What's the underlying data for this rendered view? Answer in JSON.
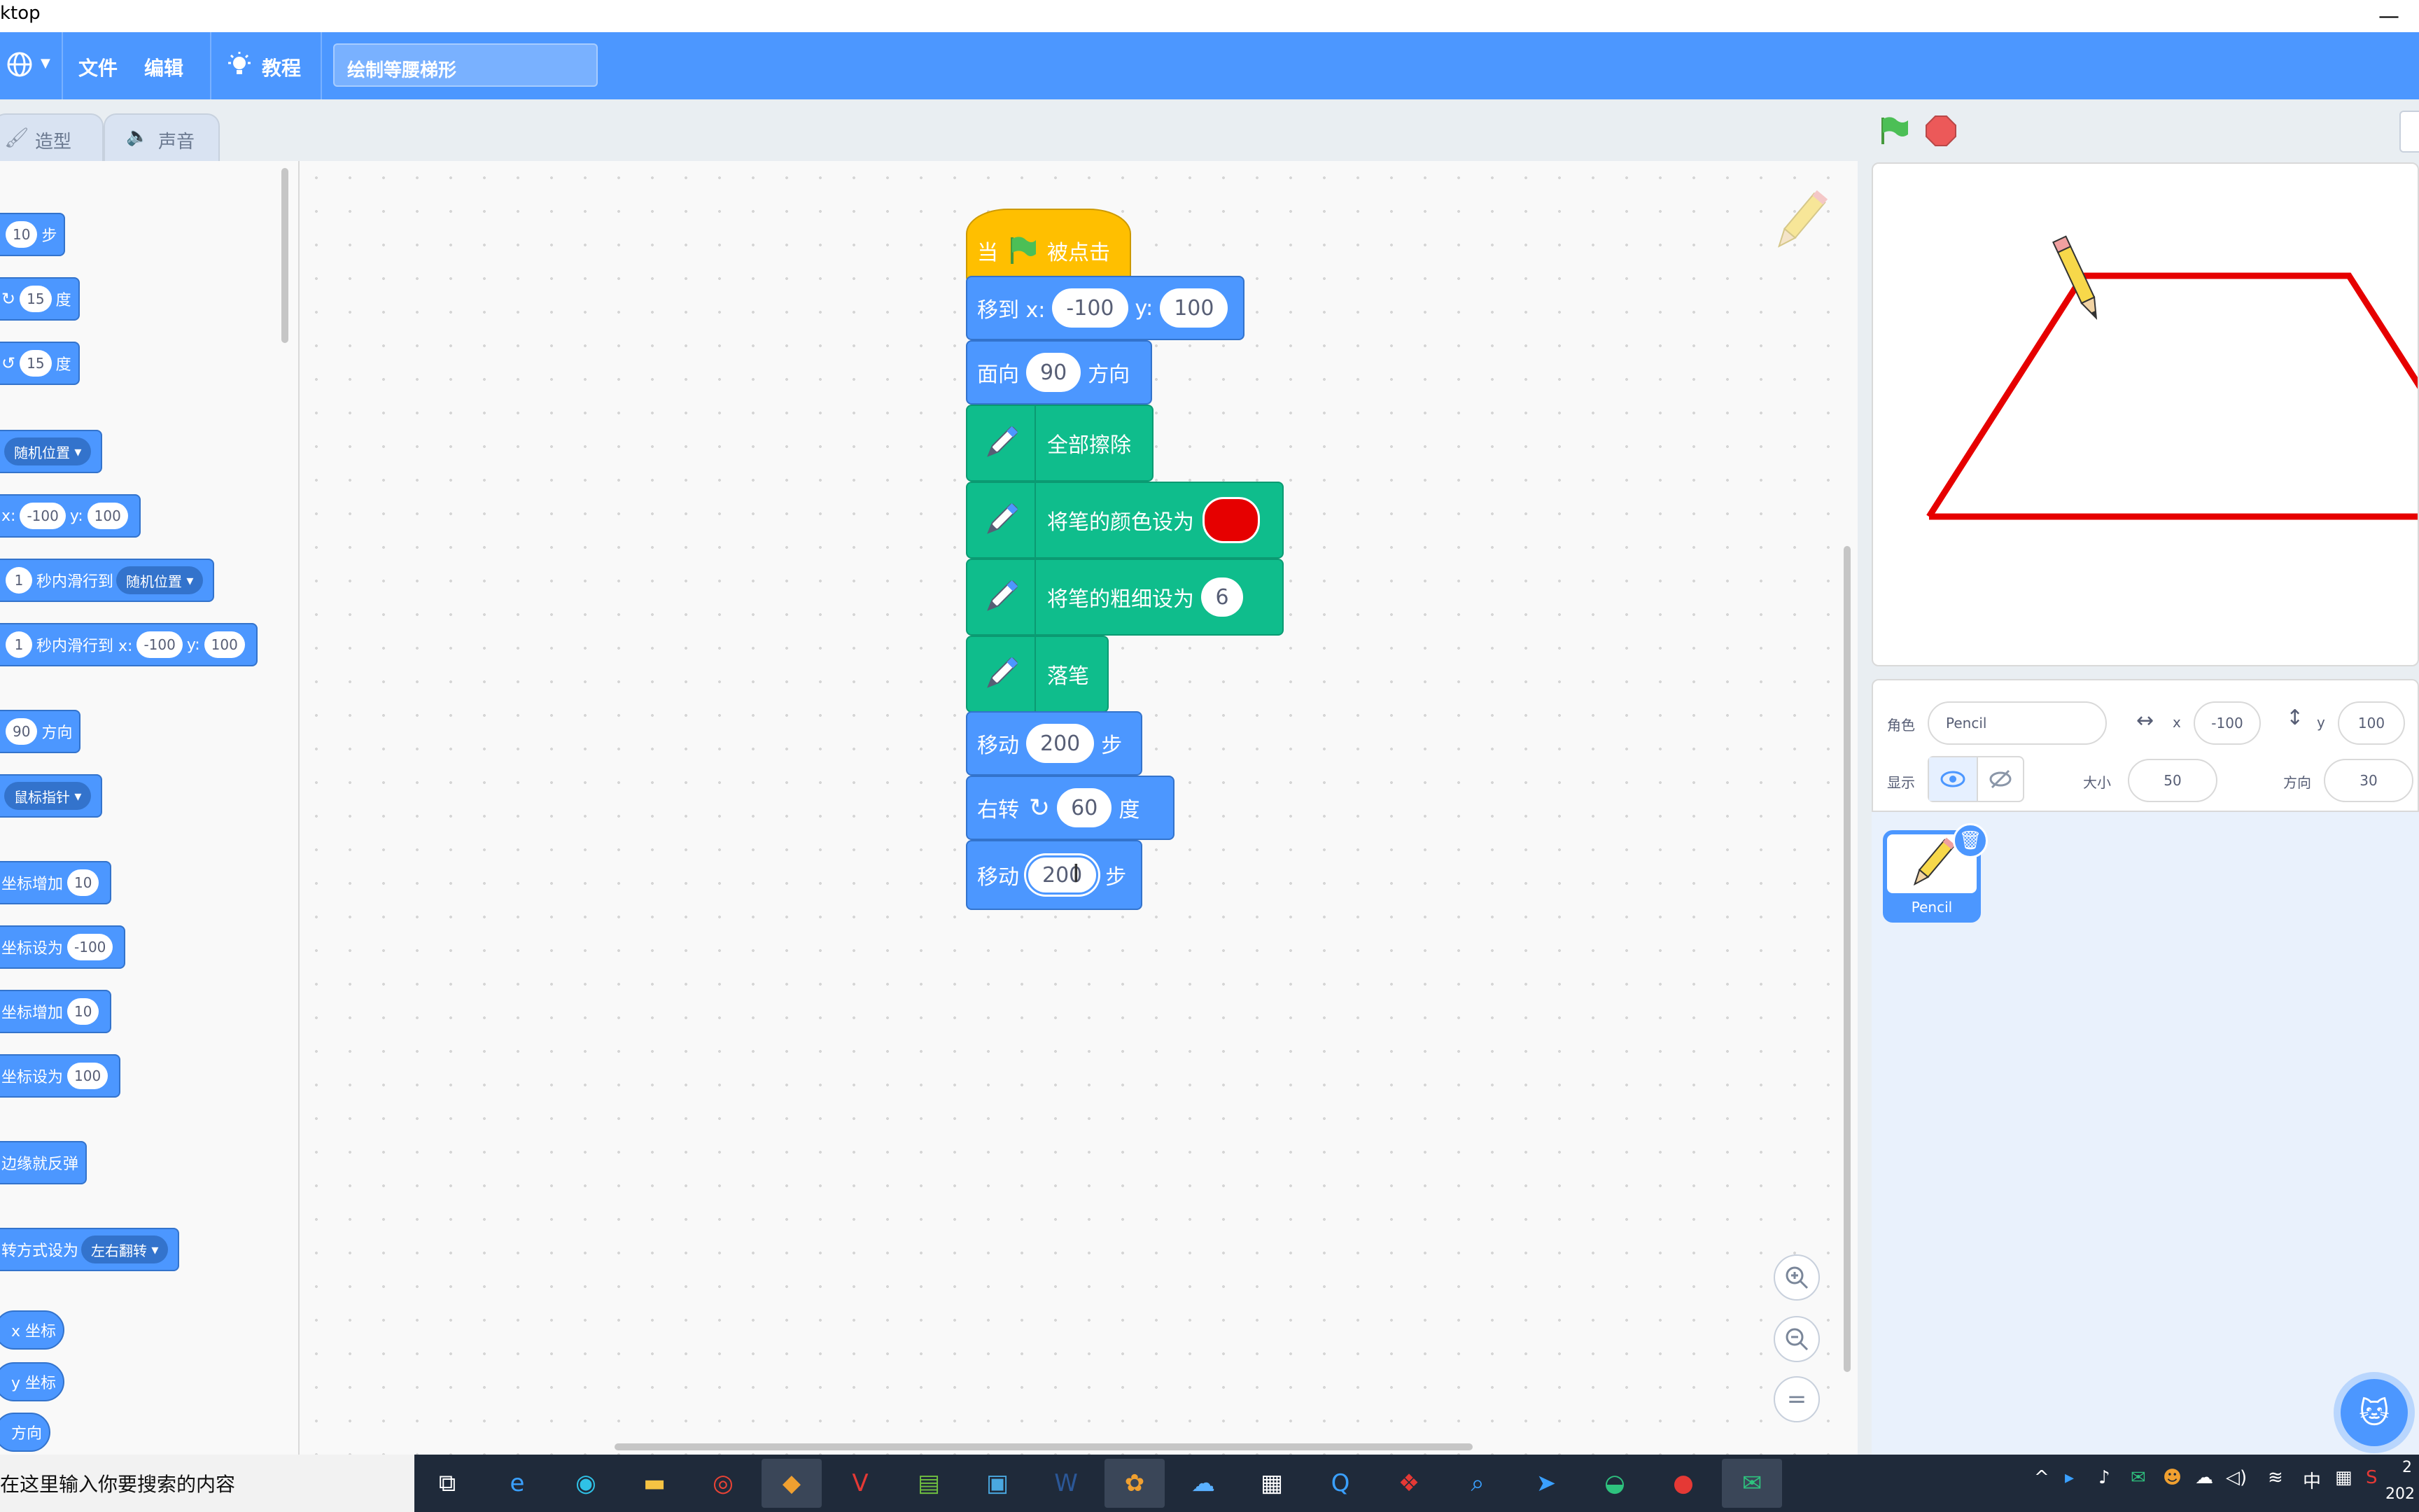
{
  "window": {
    "title": "ktop",
    "minimize_symbol": "—"
  },
  "menubar": {
    "globe_icon": "globe-icon",
    "file": "文件",
    "edit": "编辑",
    "tutorials": "教程",
    "project_title": "绘制等腰梯形"
  },
  "tabs": {
    "costumes": "造型",
    "sounds": "声音"
  },
  "palette": {
    "move_unit": "步",
    "move_value": "10",
    "turn_right_value": "15",
    "turn_right_unit": "度",
    "turn_left_value": "15",
    "turn_left_unit": "度",
    "goto_dropdown": "随机位置",
    "goto_x_label": "x:",
    "goto_x": "-100",
    "goto_y_label": "y:",
    "goto_y": "100",
    "glide_secs": "1",
    "glide_label": "秒内滑行到",
    "glide_dropdown": "随机位置",
    "glide2_secs": "1",
    "glide2_label": "秒内滑行到 x:",
    "glide2_x": "-100",
    "glide2_y_label": "y:",
    "glide2_y": "100",
    "point_dir_value": "90",
    "point_dir_unit": "方向",
    "point_towards_dropdown": "鼠标指针",
    "change_x_label": "坐标增加",
    "change_x_value": "10",
    "set_x_label": "坐标设为",
    "set_x_value": "-100",
    "change_y_label": "坐标增加",
    "change_y_value": "10",
    "set_y_label": "坐标设为",
    "set_y_value": "100",
    "bounce_label": "边缘就反弹",
    "rotation_style_label": "转方式设为",
    "rotation_style_dropdown": "左右翻转",
    "x_position": "x 坐标",
    "y_position": "y 坐标",
    "direction": "方向"
  },
  "script": {
    "when_flag_prefix": "当",
    "when_flag_suffix": "被点击",
    "goto_label": "移到 x:",
    "goto_x": "-100",
    "goto_y_label": "y:",
    "goto_y": "100",
    "point_label": "面向",
    "point_value": "90",
    "point_unit": "方向",
    "clear_label": "全部擦除",
    "set_color_label": "将笔的颜色设为",
    "set_size_label": "将笔的粗细设为",
    "set_size_value": "6",
    "pen_down_label": "落笔",
    "move1_label": "移动",
    "move1_value": "200",
    "move1_unit": "步",
    "turn_label": "右转",
    "turn_value": "60",
    "turn_unit": "度",
    "move2_label": "移动",
    "move2_value": "200",
    "move2_unit": "步"
  },
  "sprite_info": {
    "sprite_label": "角色",
    "sprite_name": "Pencil",
    "x_label": "x",
    "x_value": "-100",
    "y_label": "y",
    "y_value": "100",
    "show_label": "显示",
    "size_label": "大小",
    "size_value": "50",
    "direction_label": "方向",
    "direction_value": "30"
  },
  "sprites": [
    {
      "name": "Pencil"
    }
  ],
  "taskbar": {
    "search_placeholder": "在这里输入你要搜索的内容",
    "ime_label": "中",
    "clock_time": "2",
    "clock_date": "202"
  },
  "colors": {
    "menubar": "#4c97ff",
    "motion": "#4c97ff",
    "pen": "#0fbd8c",
    "events": "#ffbf00",
    "pen_color": "#e60000"
  }
}
